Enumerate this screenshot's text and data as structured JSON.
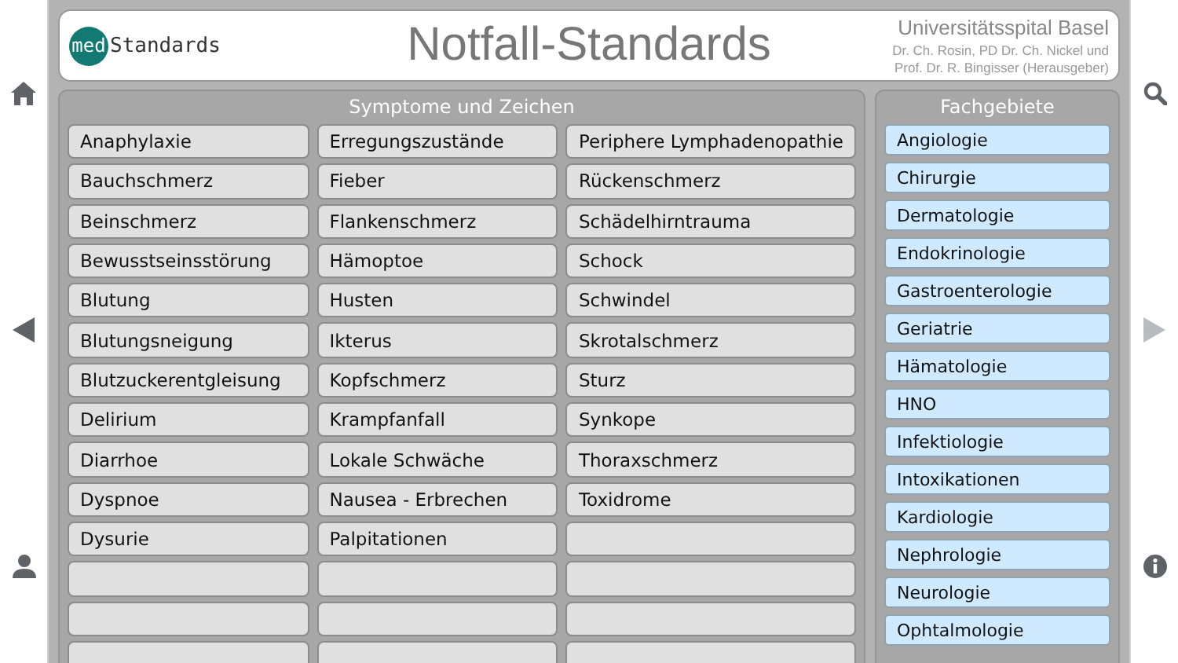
{
  "nav_left": [
    {
      "kind": "home"
    },
    {
      "kind": "back",
      "disabled": false
    },
    {
      "kind": "person"
    }
  ],
  "nav_right": [
    {
      "kind": "search"
    },
    {
      "kind": "forward",
      "disabled": true
    },
    {
      "kind": "info"
    }
  ],
  "header": {
    "logo_prefix": "med",
    "logo_suffix": "Standards",
    "title": "Notfall-Standards",
    "institution": "Universitätsspital Basel",
    "editors_line_1": "Dr. Ch. Rosin, PD Dr. Ch. Nickel und",
    "editors_line_2": "Prof. Dr. R. Bingisser (Herausgeber)"
  },
  "symptoms": {
    "title": "Symptome und Zeichen",
    "rows": [
      [
        {
          "kind": "entry",
          "label": "Anaphylaxie"
        },
        {
          "kind": "entry",
          "label": "Erregungszustände"
        },
        {
          "kind": "entry",
          "label": "Periphere Lymphadenopathie"
        }
      ],
      [
        {
          "kind": "entry",
          "label": "Bauchschmerz"
        },
        {
          "kind": "entry",
          "label": "Fieber"
        },
        {
          "kind": "entry",
          "label": "Rückenschmerz"
        }
      ],
      [
        {
          "kind": "entry",
          "label": "Beinschmerz"
        },
        {
          "kind": "entry",
          "label": "Flankenschmerz"
        },
        {
          "kind": "entry",
          "label": "Schädelhirntrauma"
        }
      ],
      [
        {
          "kind": "entry",
          "label": "Bewusstseinsstörung"
        },
        {
          "kind": "entry",
          "label": "Hämoptoe"
        },
        {
          "kind": "entry",
          "label": "Schock"
        }
      ],
      [
        {
          "kind": "entry",
          "label": "Blutung"
        },
        {
          "kind": "entry",
          "label": "Husten"
        },
        {
          "kind": "entry",
          "label": "Schwindel"
        }
      ],
      [
        {
          "kind": "entry",
          "label": "Blutungsneigung"
        },
        {
          "kind": "entry",
          "label": "Ikterus"
        },
        {
          "kind": "entry",
          "label": "Skrotalschmerz"
        }
      ],
      [
        {
          "kind": "entry",
          "label": "Blutzuckerentgleisung"
        },
        {
          "kind": "entry",
          "label": "Kopfschmerz"
        },
        {
          "kind": "entry",
          "label": "Sturz"
        }
      ],
      [
        {
          "kind": "entry",
          "label": "Delirium"
        },
        {
          "kind": "entry",
          "label": "Krampfanfall"
        },
        {
          "kind": "entry",
          "label": "Synkope"
        }
      ],
      [
        {
          "kind": "entry",
          "label": "Diarrhoe"
        },
        {
          "kind": "entry",
          "label": "Lokale Schwäche"
        },
        {
          "kind": "entry",
          "label": "Thoraxschmerz"
        }
      ],
      [
        {
          "kind": "entry",
          "label": "Dyspnoe"
        },
        {
          "kind": "entry",
          "label": "Nausea - Erbrechen"
        },
        {
          "kind": "entry",
          "label": "Toxidrome"
        }
      ],
      [
        {
          "kind": "entry",
          "label": "Dysurie"
        },
        {
          "kind": "entry",
          "label": "Palpitationen"
        },
        {
          "kind": "blank"
        }
      ],
      [
        {
          "kind": "blank"
        },
        {
          "kind": "blank"
        },
        {
          "kind": "blank"
        }
      ],
      [
        {
          "kind": "blank"
        },
        {
          "kind": "blank"
        },
        {
          "kind": "blank"
        }
      ],
      [
        {
          "kind": "blank"
        },
        {
          "kind": "blank"
        },
        {
          "kind": "blank"
        }
      ]
    ]
  },
  "specialties": {
    "title": "Fachgebiete",
    "items": [
      "Angiologie",
      "Chirurgie",
      "Dermatologie",
      "Endokrinologie",
      "Gastroenterologie",
      "Geriatrie",
      "Hämatologie",
      "HNO",
      "Infektiologie",
      "Intoxikationen",
      "Kardiologie",
      "Nephrologie",
      "Neurologie",
      "Ophtalmologie"
    ]
  }
}
